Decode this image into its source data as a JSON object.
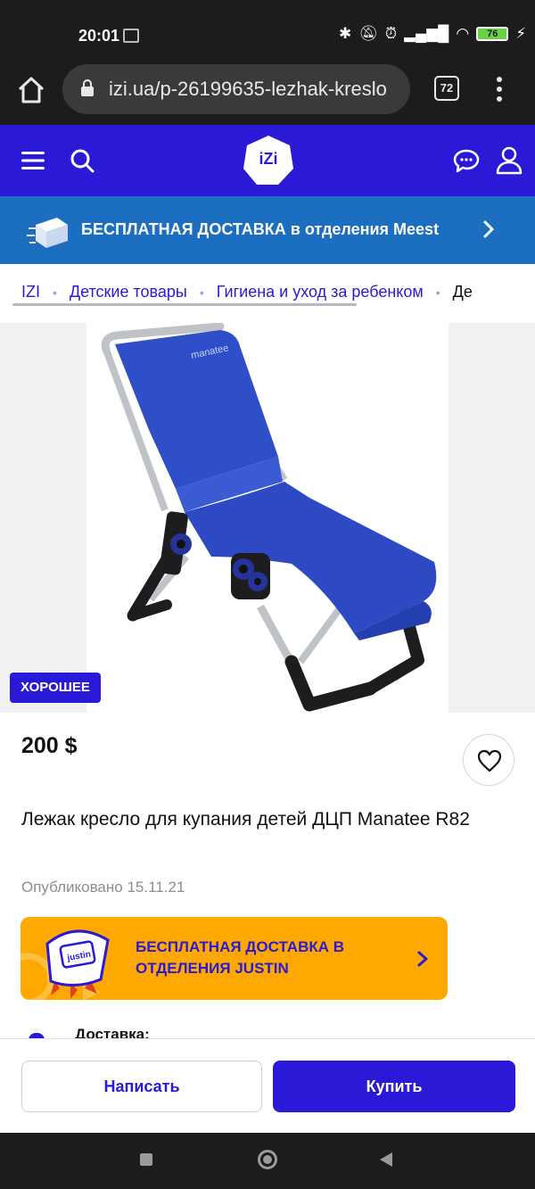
{
  "status_bar": {
    "time": "20:01",
    "battery": "76"
  },
  "browser": {
    "url": "izi.ua/p-26199635-lezhak-kreslo",
    "tab_count": "72"
  },
  "header": {
    "logo": "iZi"
  },
  "promo": {
    "text": "БЕСПЛАТНАЯ ДОСТАВКА в отделения Meest"
  },
  "breadcrumbs": [
    "IZI",
    "Детские товары",
    "Гигиена и уход за ребенком",
    "Де"
  ],
  "product": {
    "condition": "ХОРОШЕЕ",
    "price": "200 $",
    "title": "Лежак кресло для купания детей ДЦП Manatee R82",
    "published": "Опубликовано 15.11.21",
    "image_brand_text": "manatee"
  },
  "justin_banner": {
    "text": "БЕСПЛАТНАЯ ДОСТАВКА В ОТДЕЛЕНИЯ JUSTIN",
    "logo": "justin"
  },
  "delivery": {
    "label": "Доставка:"
  },
  "actions": {
    "write": "Написать",
    "buy": "Купить"
  },
  "colors": {
    "brand": "#2a1ad8",
    "promo": "#1c6fc0",
    "justin": "#ffa800",
    "chair": "#2f4fc9"
  }
}
